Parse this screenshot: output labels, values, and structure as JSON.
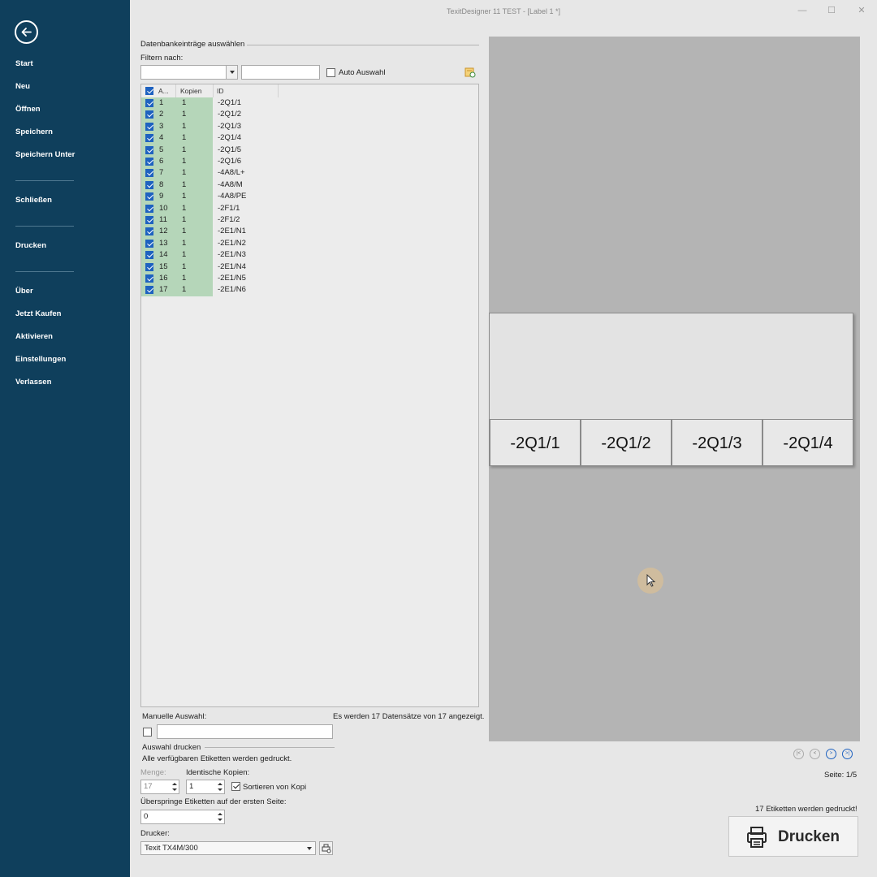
{
  "window": {
    "title": "TexitDesigner 11 TEST - [Label 1 *]",
    "minimize": "—",
    "maximize": "☐",
    "close": "✕"
  },
  "sidebar": {
    "items": [
      {
        "label": "Start"
      },
      {
        "label": "Neu"
      },
      {
        "label": "Öffnen"
      },
      {
        "label": "Speichern"
      },
      {
        "label": "Speichern Unter"
      },
      {
        "label": "Schließen"
      },
      {
        "label": "Drucken"
      },
      {
        "label": "Über"
      },
      {
        "label": "Jetzt Kaufen"
      },
      {
        "label": "Aktivieren"
      },
      {
        "label": "Einstellungen"
      },
      {
        "label": "Verlassen"
      }
    ]
  },
  "db": {
    "group_title": "Datenbankeinträge auswählen",
    "filter_label": "Filtern nach:",
    "filter_field_value": "",
    "filter_text_value": "",
    "auto_select_label": "Auto Auswahl",
    "columns": [
      "A...",
      "Kopien",
      "ID"
    ],
    "rows": [
      {
        "n": "1",
        "copies": "1",
        "id": "-2Q1/1"
      },
      {
        "n": "2",
        "copies": "1",
        "id": "-2Q1/2"
      },
      {
        "n": "3",
        "copies": "1",
        "id": "-2Q1/3"
      },
      {
        "n": "4",
        "copies": "1",
        "id": "-2Q1/4"
      },
      {
        "n": "5",
        "copies": "1",
        "id": "-2Q1/5"
      },
      {
        "n": "6",
        "copies": "1",
        "id": "-2Q1/6"
      },
      {
        "n": "7",
        "copies": "1",
        "id": "-4A8/L+"
      },
      {
        "n": "8",
        "copies": "1",
        "id": "-4A8/M"
      },
      {
        "n": "9",
        "copies": "1",
        "id": "-4A8/PE"
      },
      {
        "n": "10",
        "copies": "1",
        "id": "-2F1/1"
      },
      {
        "n": "11",
        "copies": "1",
        "id": "-2F1/2"
      },
      {
        "n": "12",
        "copies": "1",
        "id": "-2E1/N1"
      },
      {
        "n": "13",
        "copies": "1",
        "id": "-2E1/N2"
      },
      {
        "n": "14",
        "copies": "1",
        "id": "-2E1/N3"
      },
      {
        "n": "15",
        "copies": "1",
        "id": "-2E1/N4"
      },
      {
        "n": "16",
        "copies": "1",
        "id": "-2E1/N5"
      },
      {
        "n": "17",
        "copies": "1",
        "id": "-2E1/N6"
      }
    ],
    "manual_label": "Manuelle Auswahl:",
    "manual_value": "",
    "count_text": "Es werden 17 Datensätze von 17 angezeigt."
  },
  "print_selection": {
    "group_title": "Auswahl drucken",
    "all_labels_text": "Alle verfügbaren Etiketten werden gedruckt.",
    "quantity_label": "Menge:",
    "quantity_value": "17",
    "identical_copies_label": "Identische Kopien:",
    "identical_copies_value": "1",
    "sort_label": "Sortieren von Kopi",
    "skip_label": "Überspringe Etiketten auf der ersten Seite:",
    "skip_value": "0",
    "printer_label": "Drucker:",
    "printer_value": "Texit TX4M/300"
  },
  "preview": {
    "labels": [
      "-2Q1/1",
      "-2Q1/2",
      "-2Q1/3",
      "-2Q1/4"
    ],
    "pager": [
      "|<",
      "<",
      ">",
      ">|"
    ],
    "page_text": "Seite: 1/5",
    "print_summary": "17 Etiketten werden gedruckt!",
    "print_button_label": "Drucken"
  }
}
